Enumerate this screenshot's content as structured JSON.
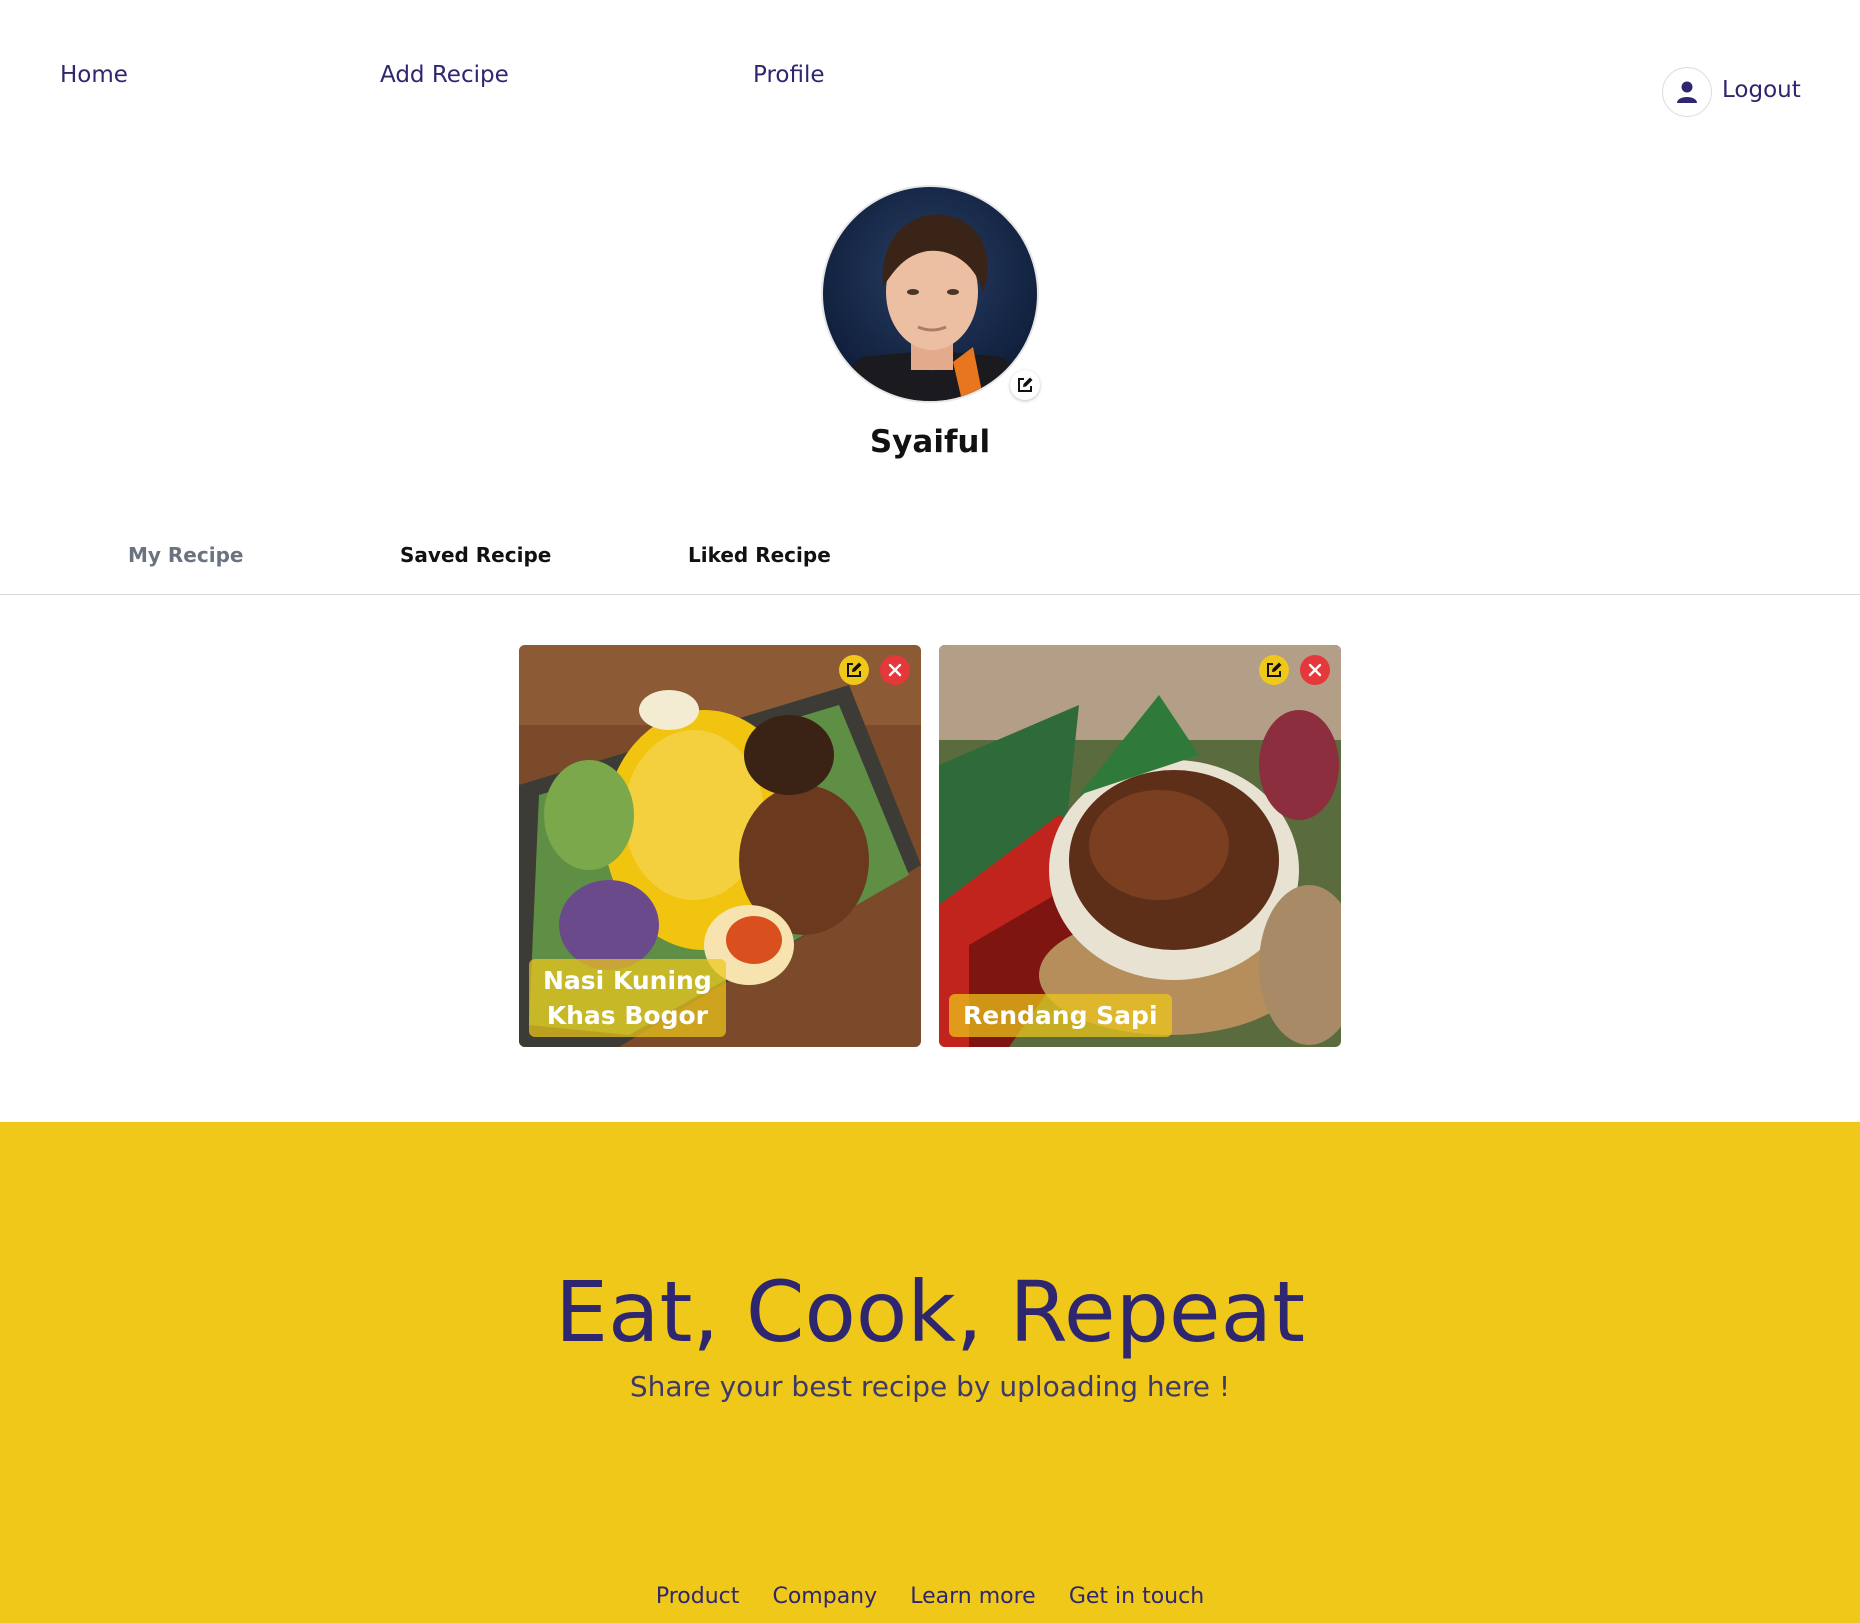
{
  "nav": {
    "home": "Home",
    "add_recipe": "Add Recipe",
    "profile": "Profile",
    "logout": "Logout"
  },
  "profile": {
    "username": "Syaiful"
  },
  "tabs": [
    {
      "label": "My Recipe",
      "active": true
    },
    {
      "label": "Saved Recipe",
      "active": false
    },
    {
      "label": "Liked Recipe",
      "active": false
    }
  ],
  "recipes": [
    {
      "title_line1": "Nasi Kuning",
      "title_line2": "Khas Bogor"
    },
    {
      "title_line1": "Rendang Sapi",
      "title_line2": ""
    }
  ],
  "footer": {
    "title": "Eat, Cook, Repeat",
    "subtitle": "Share your best recipe by uploading here !",
    "links": [
      "Product",
      "Company",
      "Learn more",
      "Get in touch"
    ]
  },
  "colors": {
    "brand_yellow": "#efc81a",
    "brand_navy": "#2e266f",
    "delete_red": "#e5383b"
  }
}
